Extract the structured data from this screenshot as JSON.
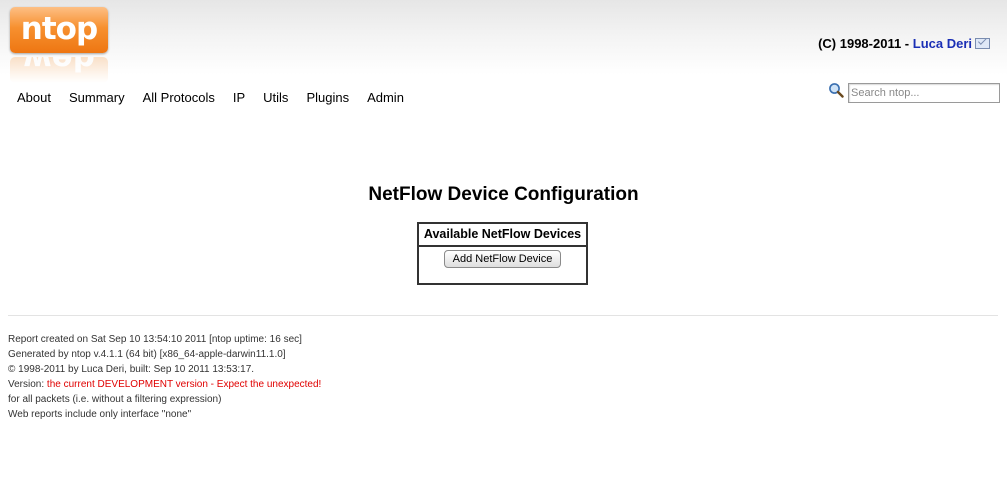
{
  "logo": {
    "text": "ntop",
    "reflection": "web"
  },
  "header": {
    "copyright_prefix": "(C) 1998-2011 - ",
    "author_link": "Luca Deri"
  },
  "nav": {
    "items": [
      "About",
      "Summary",
      "All Protocols",
      "IP",
      "Utils",
      "Plugins",
      "Admin"
    ]
  },
  "search": {
    "placeholder": "Search ntop..."
  },
  "main": {
    "title": "NetFlow Device Configuration",
    "table_header": "Available NetFlow Devices",
    "add_button": "Add NetFlow Device"
  },
  "footer": {
    "line1": "Report created on Sat Sep 10 13:54:10 2011 [ntop uptime: 16 sec]",
    "line2": "Generated by ntop v.4.1.1 (64 bit) [x86_64-apple-darwin11.1.0]",
    "line3": "© 1998-2011 by Luca Deri, built: Sep 10 2011 13:53:17.",
    "version_label": "Version: ",
    "version_value": "the current DEVELOPMENT version - Expect the unexpected!",
    "line5": "for all packets (i.e. without a filtering expression)",
    "line6": "Web reports include only interface \"none\""
  },
  "colors": {
    "logo_orange": "#f7902f",
    "link_blue": "#1a2fb5",
    "warning_red": "#e00000"
  }
}
